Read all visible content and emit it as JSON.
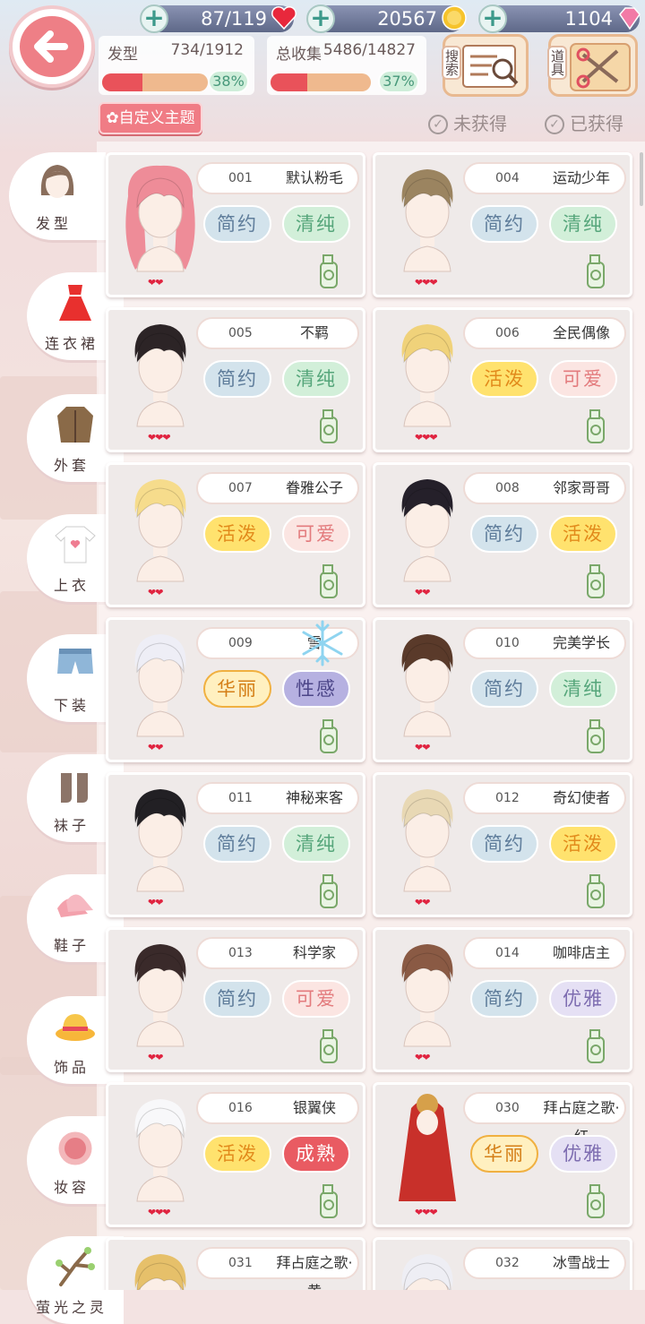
{
  "resources": {
    "stamina": "87/119",
    "coins": "20567",
    "diamonds": "1104"
  },
  "stats": {
    "hair": {
      "label": "发型",
      "count": "734/1912",
      "percent": "38%",
      "progress": 0.38
    },
    "total": {
      "label": "总收集",
      "count": "5486/14827",
      "percent": "37%",
      "progress": 0.37
    }
  },
  "buttons": {
    "search": "搜索",
    "tools": "道具",
    "custom_theme": "自定义主题",
    "not_obtained": "未获得",
    "obtained": "已获得"
  },
  "sidebar": [
    {
      "label": "发型",
      "icon": "hair-icon"
    },
    {
      "label": "连衣裙",
      "icon": "dress-icon"
    },
    {
      "label": "外套",
      "icon": "coat-icon"
    },
    {
      "label": "上衣",
      "icon": "shirt-icon"
    },
    {
      "label": "下装",
      "icon": "shorts-icon"
    },
    {
      "label": "袜子",
      "icon": "socks-icon"
    },
    {
      "label": "鞋子",
      "icon": "shoes-icon"
    },
    {
      "label": "饰品",
      "icon": "hat-icon"
    },
    {
      "label": "妆容",
      "icon": "makeup-icon"
    },
    {
      "label": "萤光之灵",
      "icon": "branch-icon"
    }
  ],
  "items": [
    {
      "num": "001",
      "name": "默认粉毛",
      "tags": [
        [
          "简约",
          "jian"
        ],
        [
          "清纯",
          "qing"
        ]
      ],
      "hearts": "❤❤",
      "hair": "#ee8c98",
      "long": true
    },
    {
      "num": "004",
      "name": "运动少年",
      "tags": [
        [
          "简约",
          "jian"
        ],
        [
          "清纯",
          "qing"
        ]
      ],
      "hearts": "❤❤❤",
      "hair": "#9b8460"
    },
    {
      "num": "005",
      "name": "不羁",
      "tags": [
        [
          "简约",
          "jian"
        ],
        [
          "清纯",
          "qing"
        ]
      ],
      "hearts": "❤❤❤",
      "hair": "#2c2426"
    },
    {
      "num": "006",
      "name": "全民偶像",
      "tags": [
        [
          "活泼",
          "huo"
        ],
        [
          "可爱",
          "ke"
        ]
      ],
      "hearts": "❤❤❤",
      "hair": "#f0d27a"
    },
    {
      "num": "007",
      "name": "眷雅公子",
      "tags": [
        [
          "活泼",
          "huo"
        ],
        [
          "可爱",
          "ke"
        ]
      ],
      "hearts": "❤❤",
      "hair": "#f6dc8c"
    },
    {
      "num": "008",
      "name": "邻家哥哥",
      "tags": [
        [
          "简约",
          "jian"
        ],
        [
          "活泼",
          "huo"
        ]
      ],
      "hearts": "❤❤",
      "hair": "#25202a"
    },
    {
      "num": "009",
      "name": "雪",
      "tags": [
        [
          "华丽",
          "hua"
        ],
        [
          "性感",
          "xing"
        ]
      ],
      "hearts": "❤❤",
      "hair": "#eeeef6"
    },
    {
      "num": "010",
      "name": "完美学长",
      "tags": [
        [
          "简约",
          "jian"
        ],
        [
          "清纯",
          "qing"
        ]
      ],
      "hearts": "❤❤",
      "hair": "#5a3a2a"
    },
    {
      "num": "011",
      "name": "神秘来客",
      "tags": [
        [
          "简约",
          "jian"
        ],
        [
          "清纯",
          "qing"
        ]
      ],
      "hearts": "❤❤",
      "hair": "#222024"
    },
    {
      "num": "012",
      "name": "奇幻使者",
      "tags": [
        [
          "简约",
          "jian"
        ],
        [
          "活泼",
          "huo"
        ]
      ],
      "hearts": "❤❤",
      "hair": "#e8d8b4"
    },
    {
      "num": "013",
      "name": "科学家",
      "tags": [
        [
          "简约",
          "jian"
        ],
        [
          "可爱",
          "ke"
        ]
      ],
      "hearts": "❤❤",
      "hair": "#3a2a2a"
    },
    {
      "num": "014",
      "name": "咖啡店主",
      "tags": [
        [
          "简约",
          "jian"
        ],
        [
          "优雅",
          "you"
        ]
      ],
      "hearts": "❤❤",
      "hair": "#8a5a44"
    },
    {
      "num": "016",
      "name": "银翼侠",
      "tags": [
        [
          "活泼",
          "huo"
        ],
        [
          "成熟",
          "cheng"
        ]
      ],
      "hearts": "❤❤❤",
      "hair": "#f8f8fa"
    },
    {
      "num": "030",
      "name": "拜占庭之歌·红",
      "tags": [
        [
          "华丽",
          "hua"
        ],
        [
          "优雅",
          "you"
        ]
      ],
      "hearts": "❤❤❤",
      "hair": "#c8302a",
      "cloak": true
    },
    {
      "num": "031",
      "name": "拜占庭之歌·黄",
      "tags": [],
      "hearts": "",
      "hair": "#e6c06a"
    },
    {
      "num": "032",
      "name": "冰雪战士",
      "tags": [],
      "hearts": "",
      "hair": "#eeeef4"
    }
  ]
}
